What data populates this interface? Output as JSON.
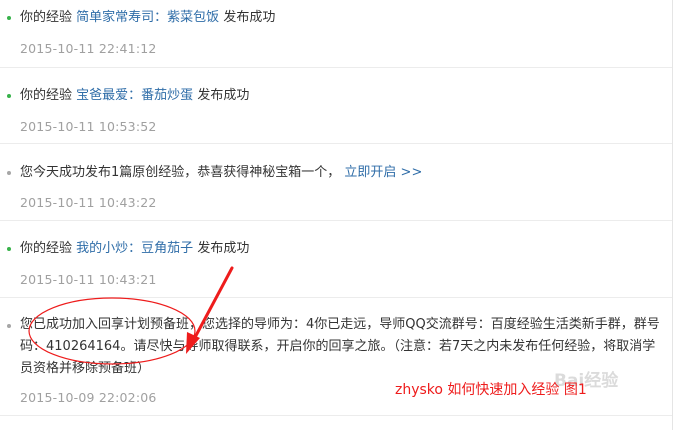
{
  "items": [
    {
      "prefix": "你的经验",
      "link": "简单家常寿司：紫菜包饭",
      "suffix": "发布成功",
      "time": "2015-10-11 22:41:12",
      "bullet": "green"
    },
    {
      "prefix": "你的经验",
      "link": "宝爸最爱：番茄炒蛋",
      "suffix": "发布成功",
      "time": "2015-10-11 10:53:52",
      "bullet": "green"
    },
    {
      "text": "您今天成功发布1篇原创经验，恭喜获得神秘宝箱一个，",
      "link": "立即开启 >>",
      "time": "2015-10-11 10:43:22",
      "bullet": "gray"
    },
    {
      "prefix": "你的经验",
      "link": "我的小炒：豆角茄子",
      "suffix": "发布成功",
      "time": "2015-10-11 10:43:21",
      "bullet": "green"
    },
    {
      "text": "您已成功加入回享计划预备班，您选择的导师为：4你已走远，导师QQ交流群号：百度经验生活类新手群，群号码：410264164。请尽快与导师取得联系，开启你的回享之旅。（注意：若7天之内未发布任何经验，将取消学员资格并移除预备班）",
      "time": "2015-10-09 22:02:06",
      "bullet": "gray"
    }
  ],
  "annotation": {
    "caption": "zhysko 如何快速加入经验 图1",
    "color": "#ee1c1c"
  },
  "watermark": {
    "text": "Bai经验"
  },
  "colors": {
    "link": "#2f6da8",
    "text": "#333333",
    "time": "#a0a0a0",
    "bullet_green": "#37b24a",
    "bullet_gray": "#a6a6a6"
  }
}
